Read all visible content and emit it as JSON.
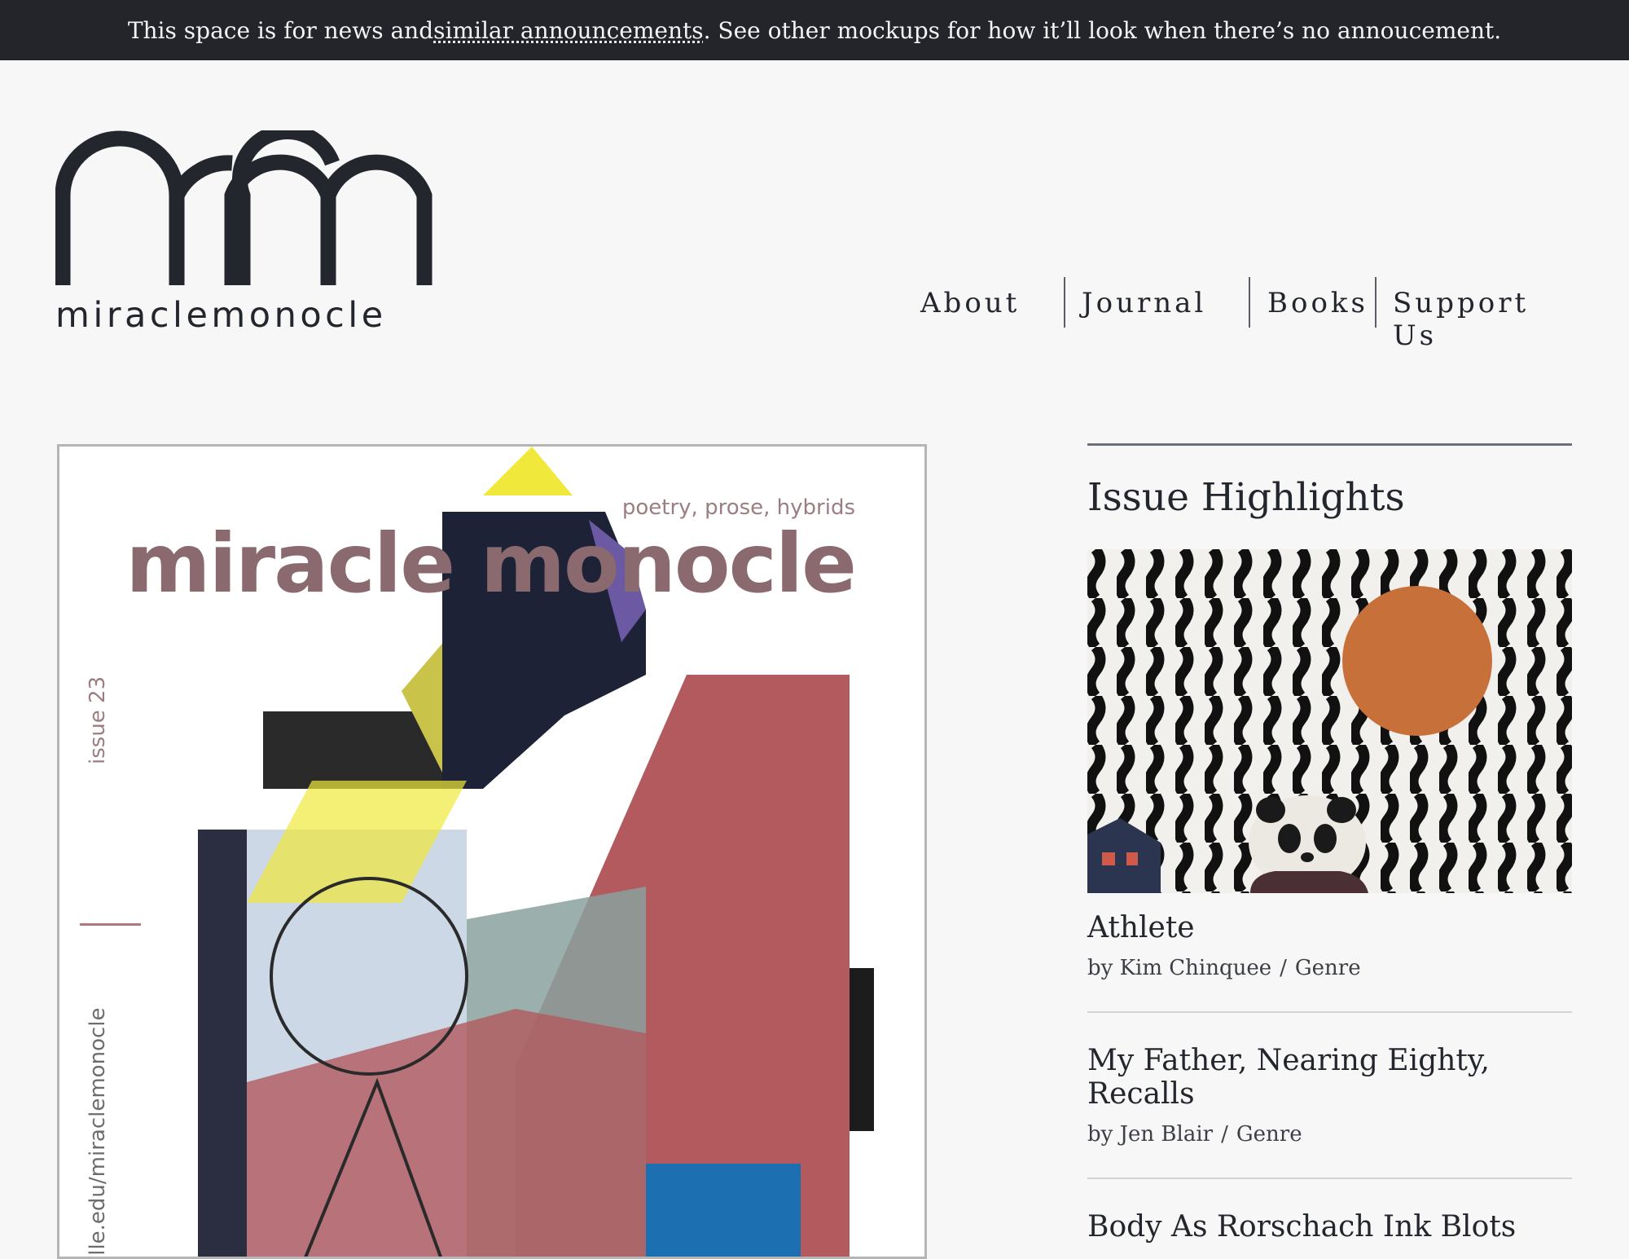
{
  "announcement": {
    "text_before": "This space is for news and ",
    "link_text": "similar announcements",
    "text_after": ". See other mockups for how it’ll look when there’s no annoucement."
  },
  "logo": {
    "wordmark": "miraclemonocle"
  },
  "nav": {
    "items": [
      "About",
      "Journal",
      "Books",
      "Support Us"
    ]
  },
  "cover": {
    "tagline": "poetry, prose, hybrids",
    "title": "miracle monocle",
    "issue": "issue 23",
    "url": "ille.edu/miraclemonocle"
  },
  "highlights": {
    "heading": "Issue Highlights",
    "items": [
      {
        "title": "Athlete",
        "by": "by Kim Chinquee",
        "genre": "Genre"
      },
      {
        "title": "My Father, Nearing Eighty, Recalls",
        "by": "by Jen Blair",
        "genre": "Genre"
      },
      {
        "title": "Body As Rorschach Ink Blots",
        "by": "",
        "genre": ""
      }
    ]
  },
  "colors": {
    "announcement_bg": "#23252b",
    "page_bg": "#f7f7f7",
    "text": "#23262d",
    "cover_title": "#8a6a6e",
    "thumb_circle": "#c8703a"
  }
}
